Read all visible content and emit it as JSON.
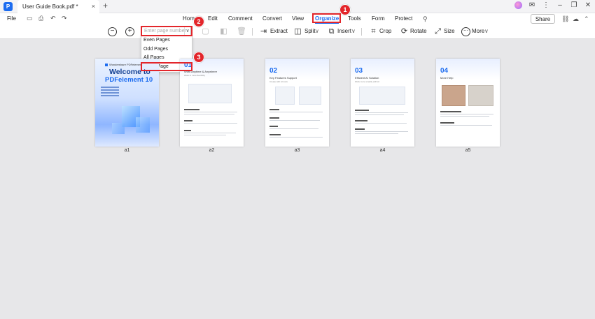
{
  "titlebar": {
    "tab_title": "User Guide Book.pdf *",
    "tab_close": "×",
    "new_tab": "+"
  },
  "menubar": {
    "file": "File",
    "tabs": [
      "Home",
      "Edit",
      "Comment",
      "Convert",
      "View",
      "Organize",
      "Tools",
      "Form",
      "Protect"
    ],
    "active_tab": "Organize",
    "share": "Share"
  },
  "toolbar": {
    "page_placeholder": "Enter page number",
    "extract": "Extract",
    "split": "Split",
    "insert": "Insert",
    "crop": "Crop",
    "rotate": "Rotate",
    "size": "Size",
    "more": "More"
  },
  "dropdown": {
    "items": [
      "Even Pages",
      "Odd Pages",
      "All Pages",
      "Blank Page"
    ]
  },
  "pages": [
    {
      "label": "a1",
      "kind": "cover",
      "brand": "Wondershare PDFelement",
      "title": "Welcome to",
      "product": "PDFelement 10"
    },
    {
      "label": "a2",
      "num": "01",
      "title": "Work Anytime & Anywhere",
      "sub": "Work in more flexibility"
    },
    {
      "label": "a3",
      "num": "02",
      "title": "Key Features Support",
      "sub": "Create with AI tools"
    },
    {
      "label": "a4",
      "num": "03",
      "title": "Efficient AI Solution",
      "sub": "Work more smartly with AI"
    },
    {
      "label": "a5",
      "num": "04",
      "title": "More Help",
      "sub": ""
    }
  ],
  "annotations": {
    "badge1": "1",
    "badge2": "2",
    "badge3": "3"
  },
  "colors": {
    "accent": "#1c6cf0",
    "annotation_red": "#e3262b",
    "canvas": "#e7e7e9"
  }
}
